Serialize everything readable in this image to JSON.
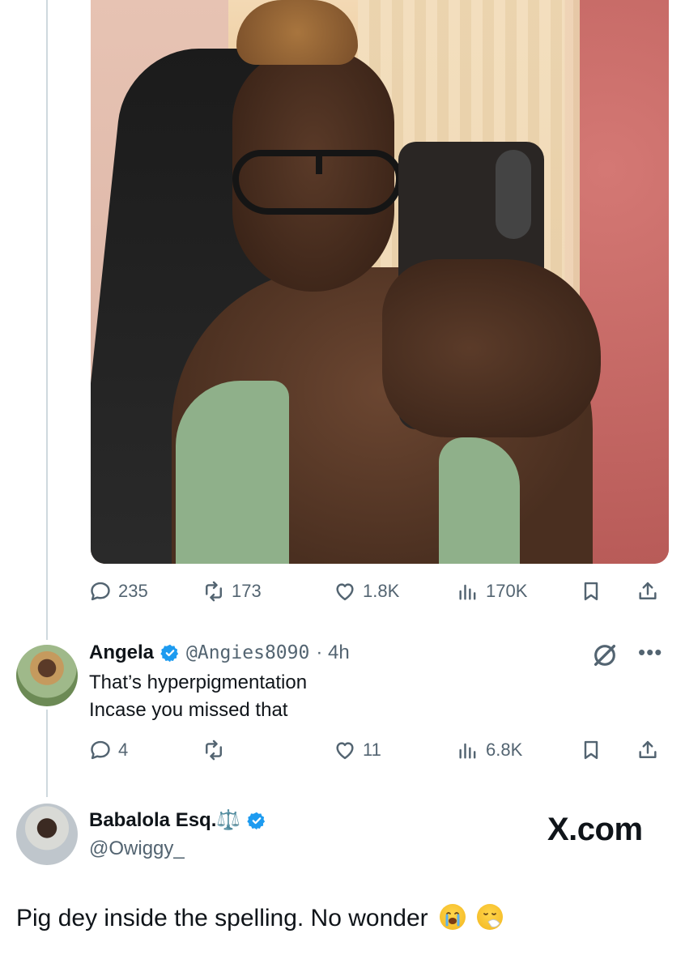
{
  "tweet": {
    "stats": {
      "replies": "235",
      "reposts": "173",
      "likes": "1.8K",
      "views": "170K"
    }
  },
  "reply": {
    "name": "Angela",
    "handle": "@Angies8090",
    "time": "· 4h",
    "text_line1": "That’s hyperpigmentation",
    "text_line2": "Incase you missed that",
    "stats": {
      "replies": "4",
      "reposts": "",
      "likes": "11",
      "views": "6.8K"
    }
  },
  "quoter": {
    "name": "Babalola Esq.⚖️",
    "handle": "@Owiggy_",
    "watermark": "X.com",
    "text": "Pig dey inside the spelling. No wonder"
  },
  "icons": {
    "reply": "reply-icon",
    "repost": "repost-icon",
    "like": "heart-icon",
    "views": "views-icon",
    "bookmark": "bookmark-icon",
    "share": "share-icon",
    "grok": "grok-icon",
    "more": "more-icon",
    "verified": "verified-badge-icon"
  },
  "colors": {
    "text": "#0f1419",
    "muted": "#536471",
    "verified": "#1d9bf0",
    "thread_line": "#cfd9de"
  }
}
